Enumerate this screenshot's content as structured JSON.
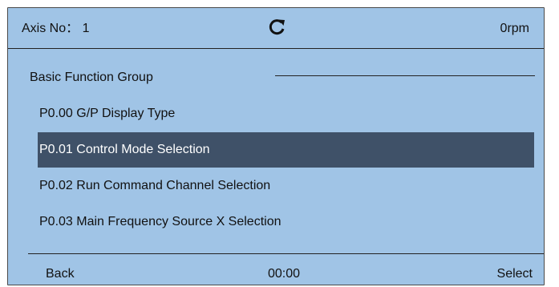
{
  "header": {
    "axis_label": "Axis No： 1",
    "refresh_icon": "refresh-icon",
    "speed": "0rpm"
  },
  "group": {
    "title": "Basic Function Group"
  },
  "menu": {
    "items": [
      {
        "label": "P0.00 G/P Display Type",
        "selected": false
      },
      {
        "label": "P0.01 Control Mode Selection",
        "selected": true
      },
      {
        "label": "P0.02 Run Command Channel Selection",
        "selected": false
      },
      {
        "label": "P0.03 Main Frequency Source X Selection",
        "selected": false
      }
    ]
  },
  "footer": {
    "back_label": "Back",
    "time": "00:00",
    "select_label": "Select"
  },
  "colors": {
    "screen_bg": "#a0c4e6",
    "selected_bg": "#3f5168",
    "selected_text": "#ffffff"
  }
}
